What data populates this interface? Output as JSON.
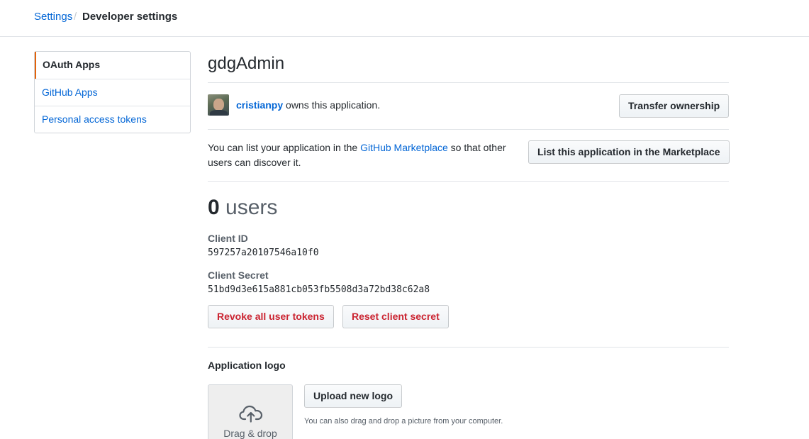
{
  "breadcrumb": {
    "settings": "Settings",
    "separator": "/",
    "current": "Developer settings"
  },
  "sidebar": {
    "items": [
      {
        "label": "OAuth Apps",
        "selected": true
      },
      {
        "label": "GitHub Apps",
        "selected": false
      },
      {
        "label": "Personal access tokens",
        "selected": false
      }
    ]
  },
  "app": {
    "name": "gdgAdmin",
    "owner_name": "cristianpy",
    "owner_suffix": " owns this application.",
    "transfer_button": "Transfer ownership",
    "marketplace_prefix": "You can list your application in the ",
    "marketplace_link": "GitHub Marketplace",
    "marketplace_suffix": " so that other users can discover it.",
    "marketplace_button": "List this application in the Marketplace",
    "users_count": "0",
    "users_label": " users",
    "client_id_label": "Client ID",
    "client_id": "597257a20107546a10f0",
    "client_secret_label": "Client Secret",
    "client_secret": "51bd9d3e615a881cb053fb5508d3a72bd38c62a8",
    "revoke_button": "Revoke all user tokens",
    "reset_button": "Reset client secret"
  },
  "logo": {
    "heading": "Application logo",
    "dropzone_text": "Drag & drop",
    "upload_button": "Upload new logo",
    "hint": "You can also drag and drop a picture from your computer."
  },
  "colors": {
    "link": "#0366d6",
    "danger": "#cb2431",
    "selected_accent": "#e36209"
  }
}
